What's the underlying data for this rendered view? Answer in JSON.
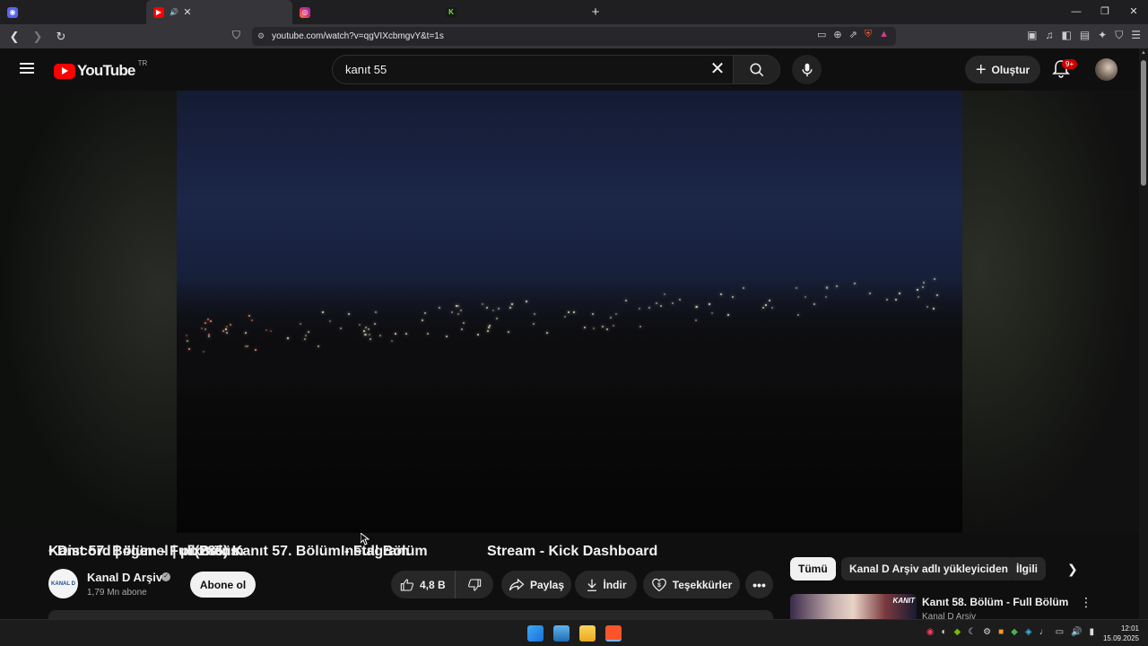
{
  "browser": {
    "tabs": [
      {
        "title": "• Discord | #genel | pixmens",
        "icon": "discord-icon",
        "color": "#5865f2"
      },
      {
        "title": "(285) Kanıt 57. Bölüm - Full Bölüm",
        "icon": "youtube-icon",
        "color": "#ff0000",
        "audio": "🔊",
        "active": true
      },
      {
        "title": "Instagram",
        "icon": "instagram-icon",
        "color": "#e1306c"
      },
      {
        "title": "Stream - Kick Dashboard",
        "icon": "kick-icon",
        "color": "#53fc18"
      }
    ],
    "url": "youtube.com/watch?v=qgVIXcbmgvY&t=1s",
    "new_tab": "+"
  },
  "youtube": {
    "region": "TR",
    "logo_text": "YouTube",
    "search_value": "kanıt 55",
    "create_label": "Oluştur",
    "notifications_badge": "9+"
  },
  "video": {
    "title": "Kanıt 57. Bölüm - Full Bölüm",
    "channel": {
      "name": "Kanal D Arşiv",
      "subscribers": "1,79 Mn abone",
      "avatar_text": "KANAL D"
    },
    "subscribe_label": "Abone ol",
    "likes": "4,8 B",
    "share_label": "Paylaş",
    "download_label": "İndir",
    "thanks_label": "Teşekkürler"
  },
  "sidebar": {
    "chips": [
      "Tümü",
      "Kanal D Arşiv adlı yükleyiciden",
      "İlgili"
    ],
    "recommendation": {
      "title": "Kanıt 58. Bölüm - Full Bölüm",
      "channel": "Kanal D Arşiv",
      "thumb_text": "KANIT"
    }
  },
  "taskbar": {
    "time": "12:01",
    "date": "15.09.2025"
  }
}
